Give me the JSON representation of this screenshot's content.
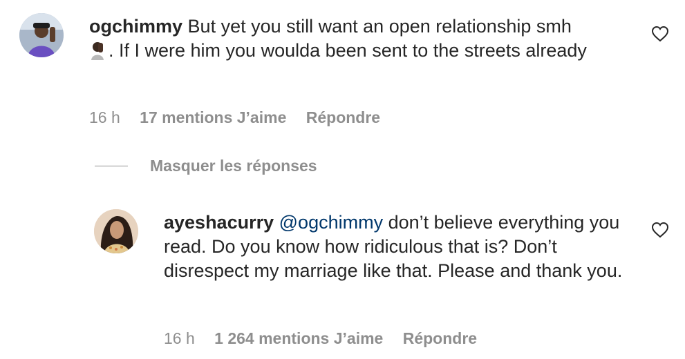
{
  "comments": [
    {
      "username": "ogchimmy",
      "text_part1": "But yet you still want an open relationship smh",
      "emoji": "facepalm-emoji",
      "text_part2": ". If I were him you woulda been sent to the streets already",
      "time": "16 h",
      "likes": "17 mentions J’aime",
      "reply": "Répondre"
    },
    {
      "username": "ayeshacurry",
      "mention": "@ogchimmy",
      "text": "don’t believe everything you read. Do you know how ridiculous that is? Don’t disrespect my marriage like that. Please and thank you.",
      "time": "16 h",
      "likes": "1 264 mentions J’aime",
      "reply": "Répondre"
    }
  ],
  "replies_toggle": "Masquer les réponses",
  "icons": {
    "like": "heart-icon"
  },
  "colors": {
    "text": "#262626",
    "secondary": "#8e8e8e",
    "mention": "#00376b"
  }
}
